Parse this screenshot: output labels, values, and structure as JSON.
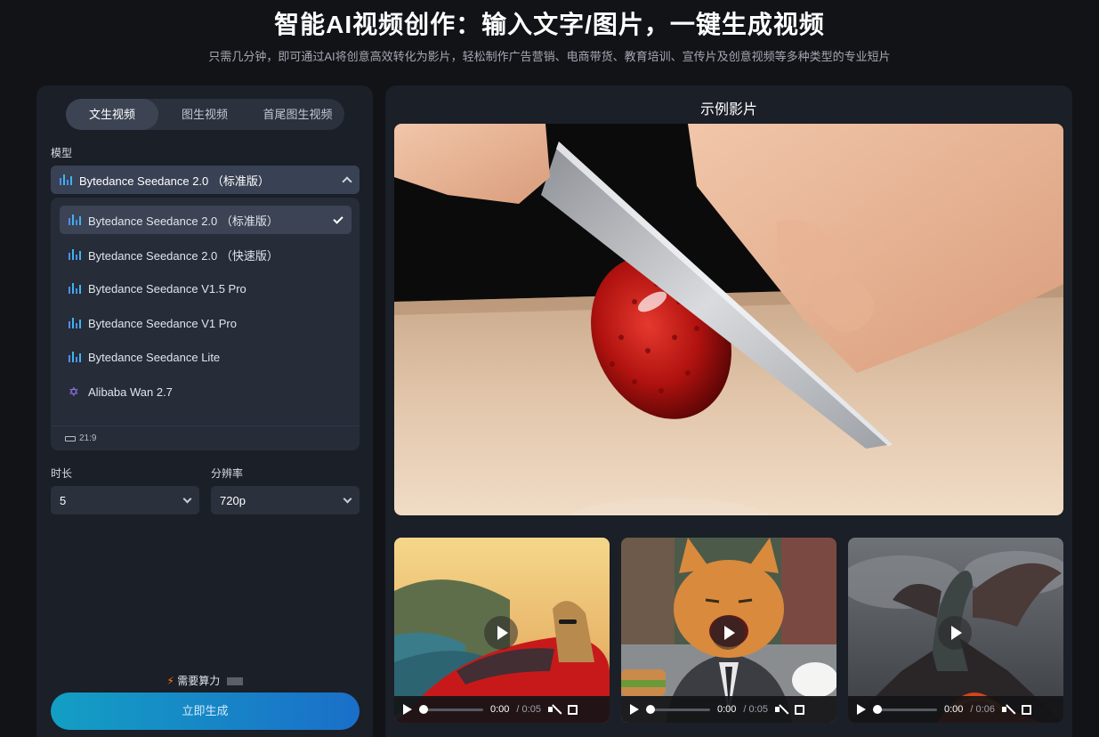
{
  "header": {
    "title": "智能AI视频创作：输入文字/图片，一键生成视频",
    "subtitle": "只需几分钟，即可通过AI将创意高效转化为影片，轻松制作广告营销、电商带货、教育培训、宣传片及创意视频等多种类型的专业短片"
  },
  "left_panel": {
    "tabs": [
      {
        "label": "文生视频",
        "active": true
      },
      {
        "label": "图生视频",
        "active": false
      },
      {
        "label": "首尾图生视频",
        "active": false
      }
    ],
    "model_label": "模型",
    "model_selected": "Bytedance Seedance 2.0 （标准版）",
    "model_options": [
      {
        "label": "Bytedance Seedance 2.0 （标准版）",
        "icon": "bars-icon",
        "selected": true
      },
      {
        "label": "Bytedance Seedance 2.0 （快速版）",
        "icon": "bars-icon",
        "selected": false
      },
      {
        "label": "Bytedance Seedance V1.5 Pro",
        "icon": "bars-icon",
        "selected": false
      },
      {
        "label": "Bytedance Seedance V1 Pro",
        "icon": "bars-icon",
        "selected": false
      },
      {
        "label": "Bytedance Seedance Lite",
        "icon": "bars-icon",
        "selected": false
      },
      {
        "label": "Alibaba Wan 2.7",
        "icon": "wan-logo-icon",
        "selected": false
      }
    ],
    "aspect_ratio": "21:9",
    "duration_label": "时长",
    "duration_value": "5",
    "resolution_label": "分辨率",
    "resolution_value": "720p",
    "cost_label": "需要算力",
    "generate_label": "立即生成"
  },
  "right_panel": {
    "title": "示例影片",
    "thumbnails": [
      {
        "current": "0:00",
        "duration": "0:05"
      },
      {
        "current": "0:00",
        "duration": "0:05"
      },
      {
        "current": "0:00",
        "duration": "0:06"
      }
    ]
  },
  "colors": {
    "background": "#111317",
    "panel": "#1b1f27",
    "accent_start": "#139fc4",
    "accent_end": "#1a6fc9",
    "bolt": "#ff7a1a"
  }
}
